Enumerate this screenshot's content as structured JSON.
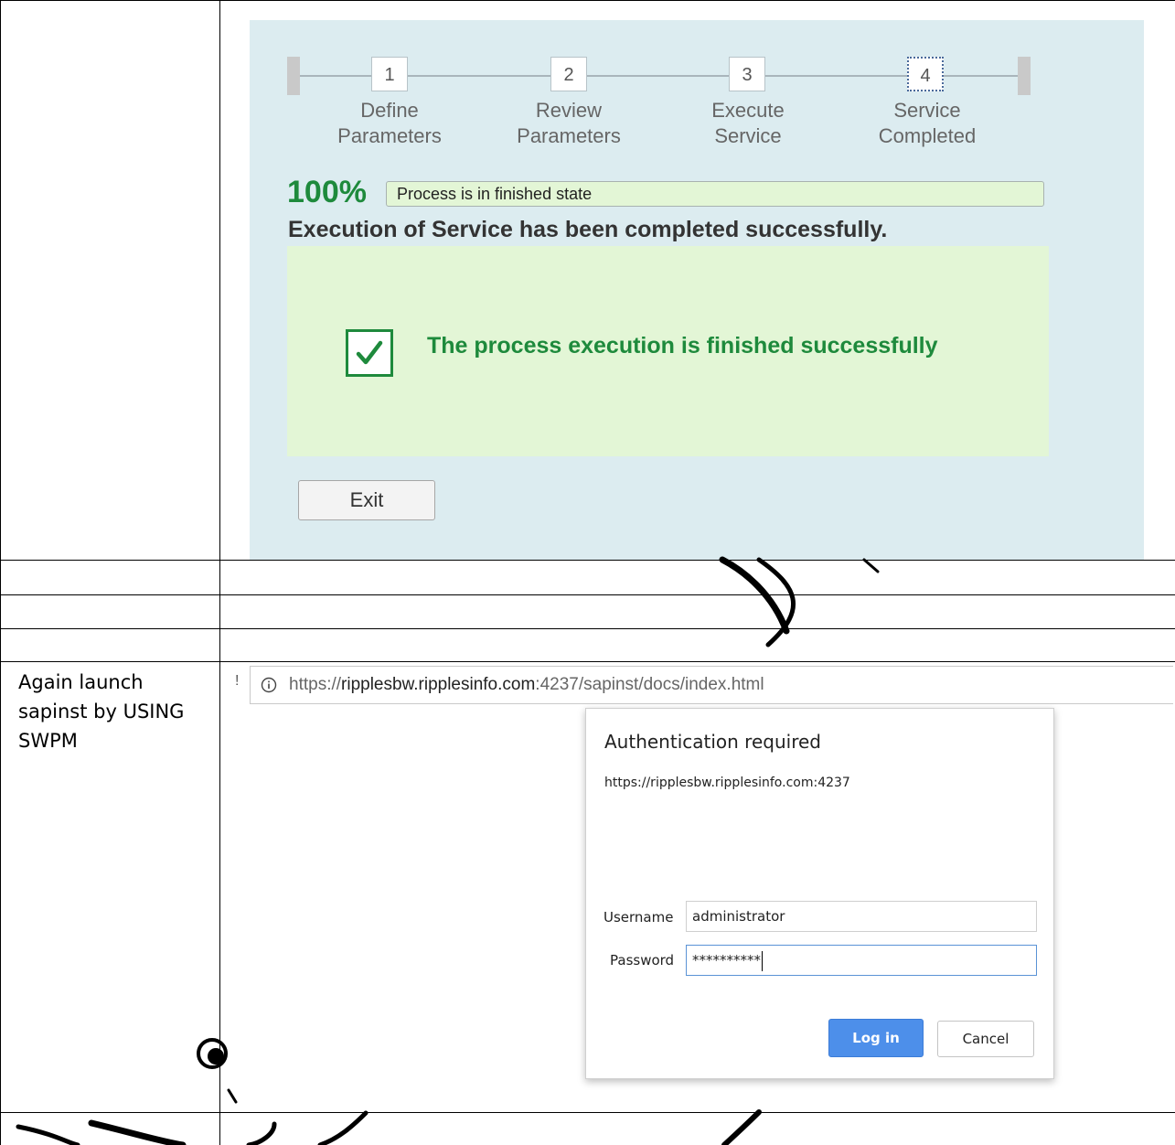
{
  "installer": {
    "steps": [
      {
        "number": "1",
        "line1": "Define",
        "line2": "Parameters"
      },
      {
        "number": "2",
        "line1": "Review",
        "line2": "Parameters"
      },
      {
        "number": "3",
        "line1": "Execute",
        "line2": "Service"
      },
      {
        "number": "4",
        "line1": "Service",
        "line2": "Completed"
      }
    ],
    "active_step": 4,
    "progress_percent_label": "100%",
    "progress_fraction": 1.0,
    "progress_status": "Process is in finished state",
    "execution_message": "Execution of Service has been completed successfully.",
    "success_message": "The process execution is finished successfully",
    "exit_label": "Exit"
  },
  "instruction": {
    "text": "Again launch sapinst by USING SWPM"
  },
  "browser": {
    "url_scheme": "https://",
    "url_host": "ripplesbw.ripplesinfo.com",
    "url_rest": ":4237/sapinst/docs/index.html",
    "left_glyph": "!"
  },
  "auth_dialog": {
    "title": "Authentication required",
    "origin": "https://ripplesbw.ripplesinfo.com:4237",
    "username_label": "Username",
    "username_value": "administrator",
    "password_label": "Password",
    "password_value": "**********",
    "login_label": "Log in",
    "cancel_label": "Cancel"
  },
  "colors": {
    "installer_background": "#dcecf0",
    "success_green": "#1e8a3c",
    "success_panel": "#e3f6d6",
    "login_button": "#4d8fea"
  }
}
